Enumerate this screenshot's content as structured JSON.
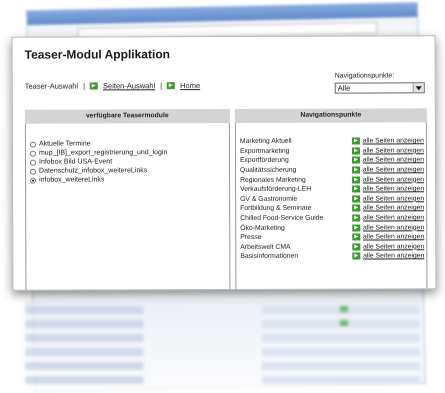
{
  "app_title": "Teaser-Modul Applikation",
  "nav": {
    "teaser_auswahl": "Teaser-Auswahl",
    "separator": "|",
    "seiten_auswahl": "Seiten-Auswahl",
    "home": "Home"
  },
  "nav_select": {
    "label": "Navigationspunkte:",
    "selected": "Alle"
  },
  "headers": {
    "left": "verfügbare Teasermodule",
    "right": "Navigationspunkte"
  },
  "teasers": [
    {
      "label": "Aktuelle Termine",
      "checked": false
    },
    {
      "label": "mup_[IB]_export_registrierung_und_login",
      "checked": false
    },
    {
      "label": "Infobox Bild USA-Event",
      "checked": false
    },
    {
      "label": "Datenschutz_infobox_weitereLinks",
      "checked": false
    },
    {
      "label": "infobox_weitereLinks",
      "checked": true
    }
  ],
  "nav_points": [
    "Marketing Aktuell",
    "Exportmarketing",
    "Exportförderung",
    "Qualitätssicherung",
    "Regionales Marketing",
    "Verkaufsförderung-LEH",
    "GV & Gastronomie",
    "Fortbildung & Seminare",
    "Chilled Food-Service Guide",
    "Öko-Marketing",
    "Presse",
    "Arbeitswelt CMA",
    "Basisinformationen"
  ],
  "link_label": "alle Seiten anzeigen",
  "colors": {
    "arrow_green": "#3a9a2e",
    "header_gray": "#d4d4d4"
  }
}
